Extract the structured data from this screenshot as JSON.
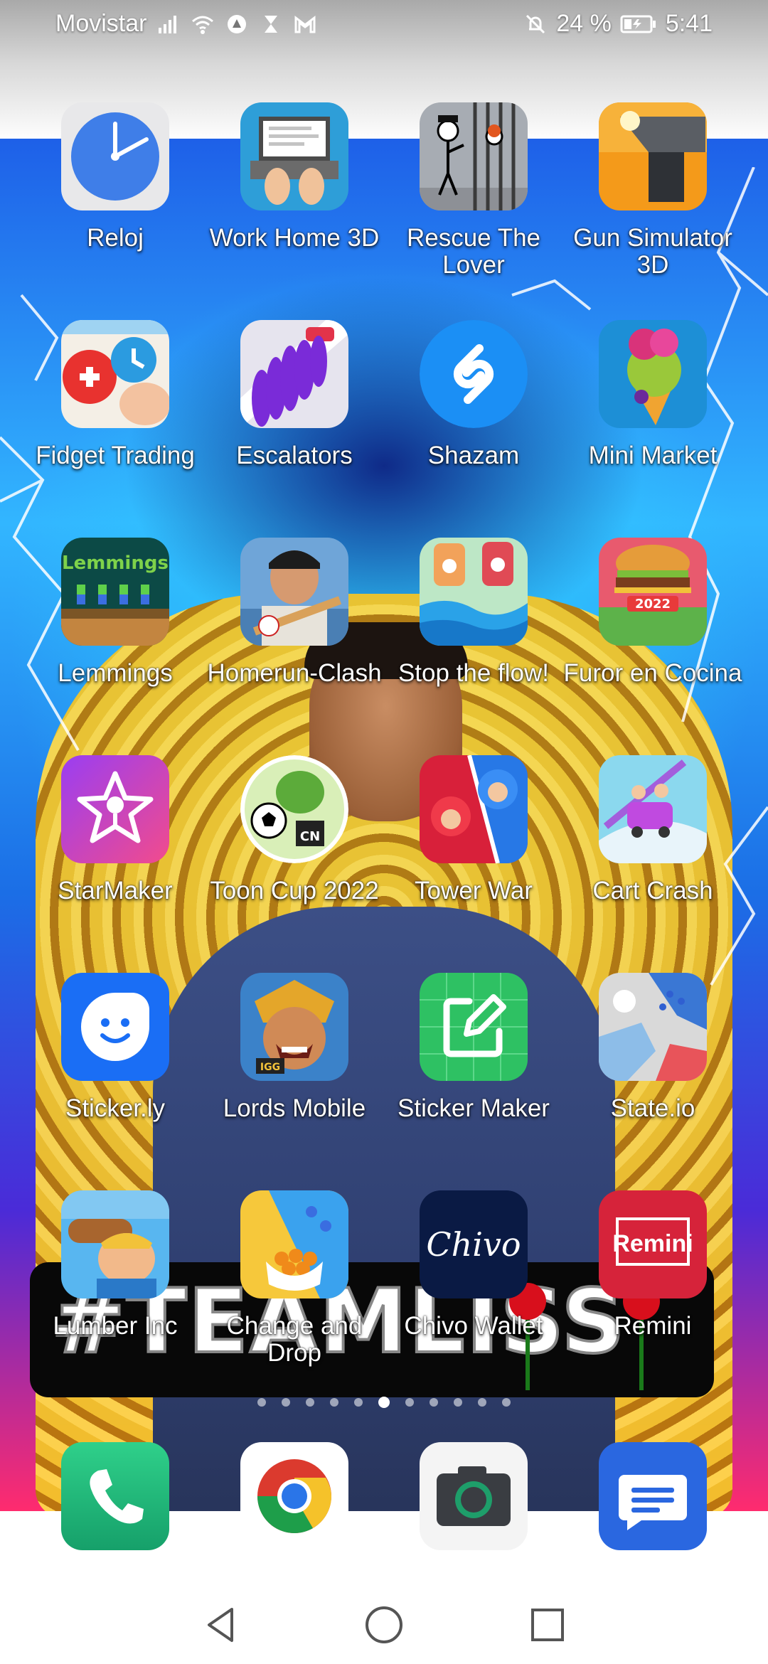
{
  "status_bar": {
    "carrier": "Movistar",
    "battery": "24 %",
    "time": "5:41",
    "left_icons": [
      "signal-icon",
      "wifi-icon",
      "vpn-icon",
      "hourglass-icon",
      "gmail-icon"
    ],
    "right_icons": [
      "mute-bell-icon",
      "battery-icon"
    ]
  },
  "wallpaper": {
    "banner_text": "#TEAMLISS"
  },
  "apps": [
    {
      "name": "Reloj",
      "icon": "clock-icon"
    },
    {
      "name": "Work Home 3D",
      "icon": "laptop-icon"
    },
    {
      "name": "Rescue The Lover",
      "icon": "stickman-jail-icon"
    },
    {
      "name": "Gun Simulator 3D",
      "icon": "gun-icon"
    },
    {
      "name": "Fidget Trading",
      "icon": "fidget-icon"
    },
    {
      "name": "Escalators",
      "icon": "crowd-icon"
    },
    {
      "name": "Shazam",
      "icon": "shazam-icon"
    },
    {
      "name": "Mini Market",
      "icon": "icecream-icon"
    },
    {
      "name": "Lemmings",
      "icon": "lemmings-icon"
    },
    {
      "name": "Homerun-Clash",
      "icon": "baseball-icon"
    },
    {
      "name": "Stop the flow!",
      "icon": "flow-icon"
    },
    {
      "name": "Furor en Cocina",
      "icon": "burger-icon"
    },
    {
      "name": "StarMaker",
      "icon": "star-mic-icon"
    },
    {
      "name": "Toon Cup 2022",
      "icon": "soccer-icon"
    },
    {
      "name": "Tower War",
      "icon": "tower-war-icon"
    },
    {
      "name": "Cart Crash",
      "icon": "cart-icon"
    },
    {
      "name": "Sticker.ly",
      "icon": "smiley-icon"
    },
    {
      "name": "Lords Mobile",
      "icon": "warrior-icon"
    },
    {
      "name": "Sticker Maker",
      "icon": "sticker-edit-icon"
    },
    {
      "name": "State.io",
      "icon": "map-icon"
    },
    {
      "name": "Lumber Inc",
      "icon": "lumberjack-icon"
    },
    {
      "name": "Change and Drop",
      "icon": "balls-icon"
    },
    {
      "name": "Chivo Wallet",
      "icon": "chivo-icon",
      "logo_text": "Chivo"
    },
    {
      "name": "Remini",
      "icon": "remini-icon",
      "logo_text": "Remini"
    }
  ],
  "page_indicator": {
    "pages": 11,
    "current": 6
  },
  "dock": [
    {
      "name": "Phone",
      "icon": "phone-icon"
    },
    {
      "name": "Chrome",
      "icon": "chrome-icon"
    },
    {
      "name": "Camera",
      "icon": "camera-icon"
    },
    {
      "name": "Messages",
      "icon": "messages-icon"
    }
  ],
  "nav": [
    "back-icon",
    "home-icon",
    "recents-icon"
  ]
}
